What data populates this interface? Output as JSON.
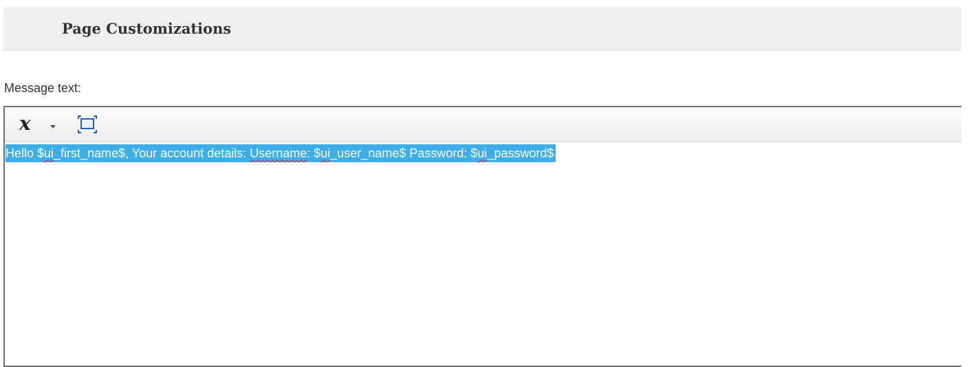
{
  "section": {
    "title": "Page Customizations"
  },
  "message_field": {
    "label": "Message text:"
  },
  "toolbar": {
    "format_icon": "remove-format-icon",
    "dropdown_icon": "caret-down-icon",
    "maximize_icon": "maximize-icon"
  },
  "editor": {
    "segments": [
      "Hello $",
      "ui",
      "_first_name$, Your account details: ",
      "Username",
      ": $",
      "ui",
      "_user_name$ Password: $",
      "ui",
      "_password$"
    ],
    "selection_color": "#3daee9",
    "spellcheck_color": "#e02020"
  }
}
